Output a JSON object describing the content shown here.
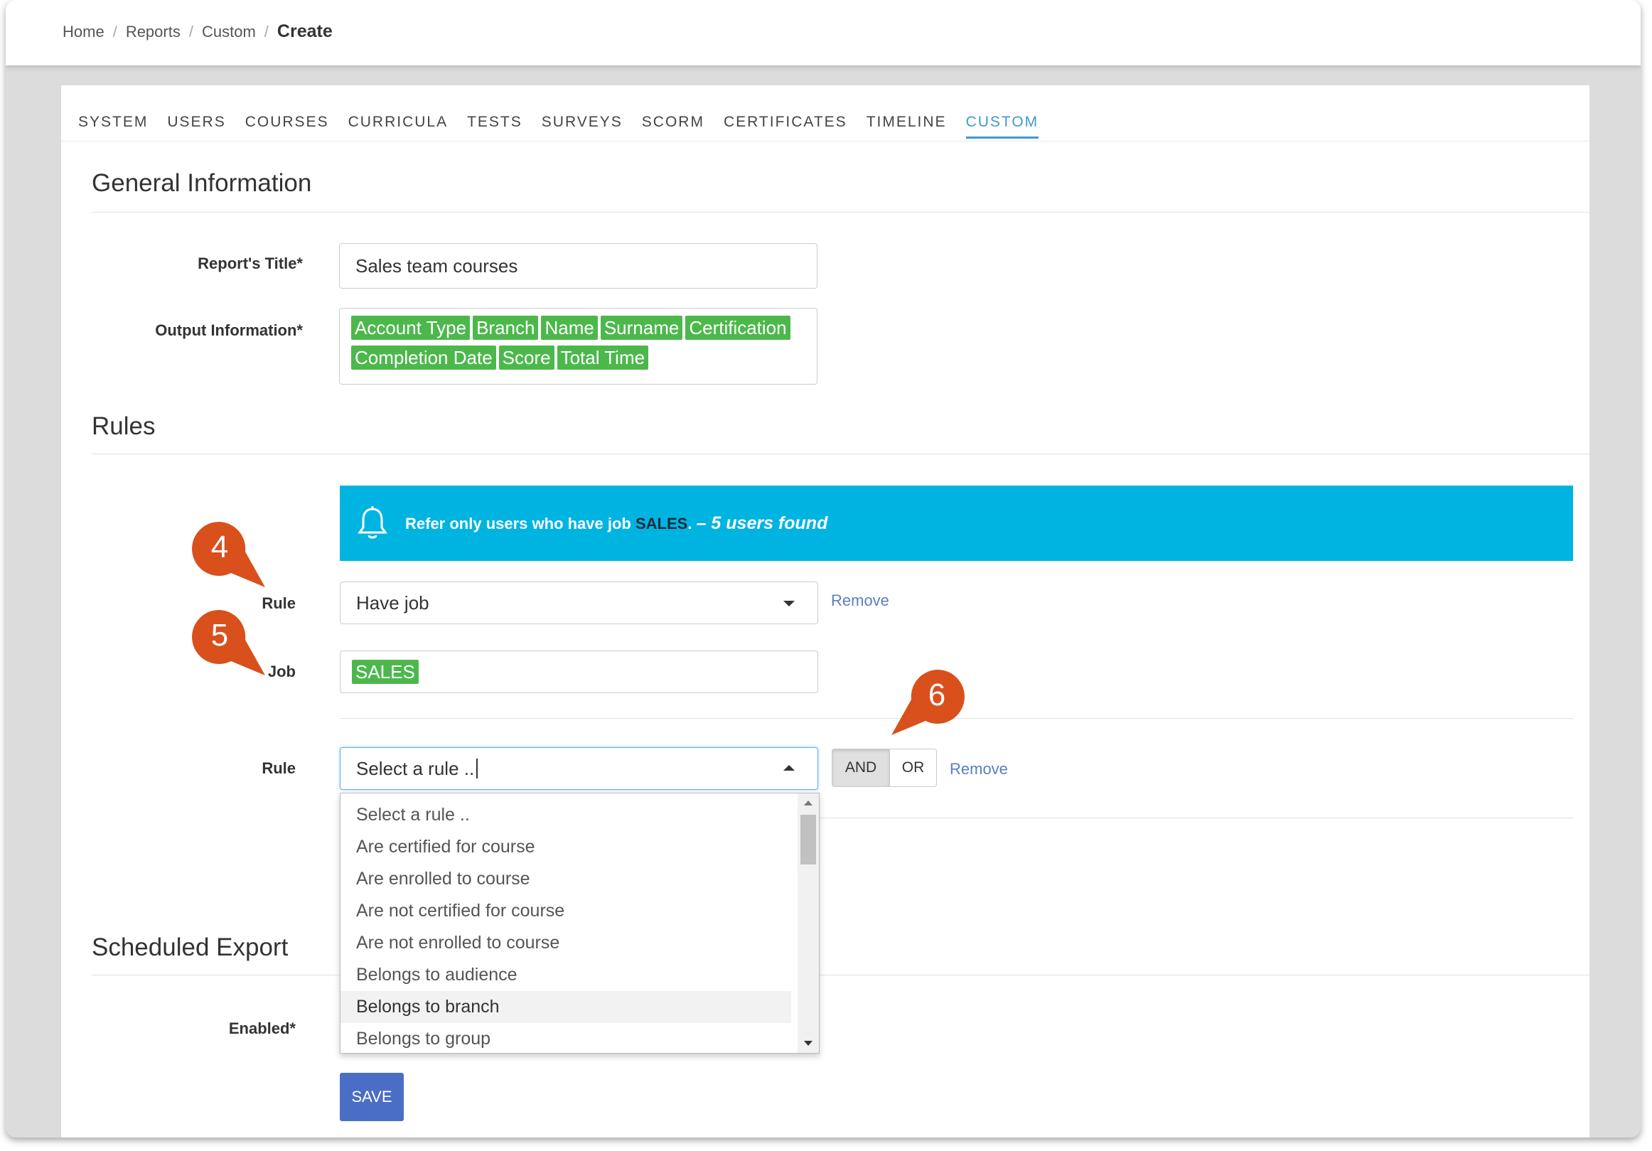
{
  "breadcrumb": {
    "items": [
      "Home",
      "Reports",
      "Custom"
    ],
    "current": "Create",
    "separator": "/"
  },
  "tabs": [
    {
      "label": "SYSTEM"
    },
    {
      "label": "USERS"
    },
    {
      "label": "COURSES"
    },
    {
      "label": "CURRICULA"
    },
    {
      "label": "TESTS"
    },
    {
      "label": "SURVEYS"
    },
    {
      "label": "SCORM"
    },
    {
      "label": "CERTIFICATES"
    },
    {
      "label": "TIMELINE"
    },
    {
      "label": "CUSTOM",
      "active": true
    }
  ],
  "general": {
    "title": "General Information",
    "report_title_label": "Report's Title*",
    "report_title_value": "Sales team courses",
    "output_label": "Output Information*",
    "output_tags": [
      "Account Type",
      "Branch",
      "Name",
      "Surname",
      "Certification",
      "Completion Date",
      "Score",
      "Total Time"
    ]
  },
  "rules": {
    "title": "Rules",
    "alert": {
      "prefix": "Refer only users who have job ",
      "job": "SALES",
      "suffix": ". ",
      "found": "– 5 users found"
    },
    "rule1_label": "Rule",
    "rule1_value": "Have job",
    "remove_label": "Remove",
    "job_label": "Job",
    "job_tag": "SALES",
    "rule2_label": "Rule",
    "rule2_value": "Select a rule ..",
    "and_label": "AND",
    "or_label": "OR",
    "dropdown_options": [
      "Select a rule ..",
      "Are certified for course",
      "Are enrolled to course",
      "Are not certified for course",
      "Are not enrolled to course",
      "Belongs to audience",
      "Belongs to branch",
      "Belongs to group"
    ],
    "hovered_option": "Belongs to branch"
  },
  "scheduled": {
    "title": "Scheduled Export",
    "enabled_label": "Enabled*"
  },
  "save_label": "SAVE",
  "markers": [
    "4",
    "5",
    "6"
  ],
  "colors": {
    "tag_green": "#4cb84c",
    "alert_blue": "#00b4e2",
    "active_tab": "#3d9ad1",
    "marker_orange": "#d9501c",
    "save_blue": "#4a6ec5"
  }
}
